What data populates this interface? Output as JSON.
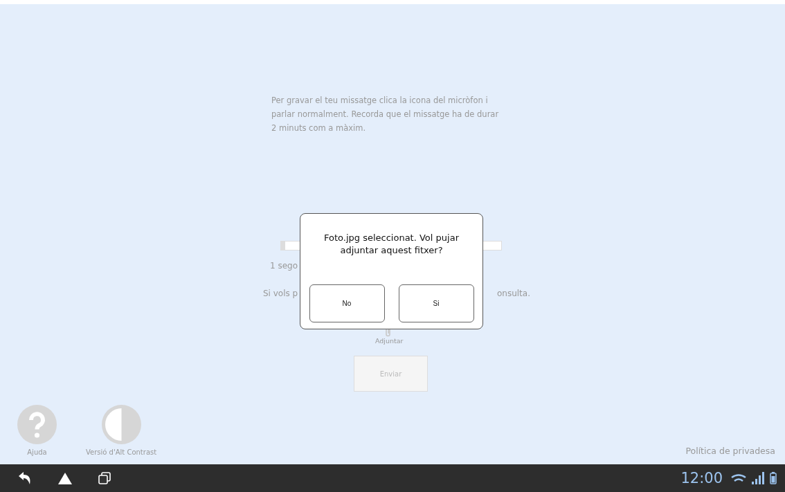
{
  "instructions": "Per gravar el teu missatge clica la icona del micròfon i parlar normalment.  Recorda que el missatge ha de durar 2 minuts com a màxim.",
  "recording": {
    "level": 0.02,
    "duration_visible": "1 sego"
  },
  "upload_hint": {
    "left_visible": "Si vols p",
    "right_visible": "onsulta."
  },
  "attach": {
    "label": "Adjuntar"
  },
  "send_button": {
    "label": "Enviar",
    "disabled": true
  },
  "footer": {
    "help": "Ajuda",
    "contrast": "Versió d'Alt Contrast",
    "privacy": "Política de privadesa"
  },
  "dialog": {
    "message": "Foto.jpg seleccionat. Vol pujar adjuntar aquest fitxer?",
    "buttons": [
      "No",
      "Si"
    ]
  },
  "status_bar": {
    "time": "12:00"
  }
}
